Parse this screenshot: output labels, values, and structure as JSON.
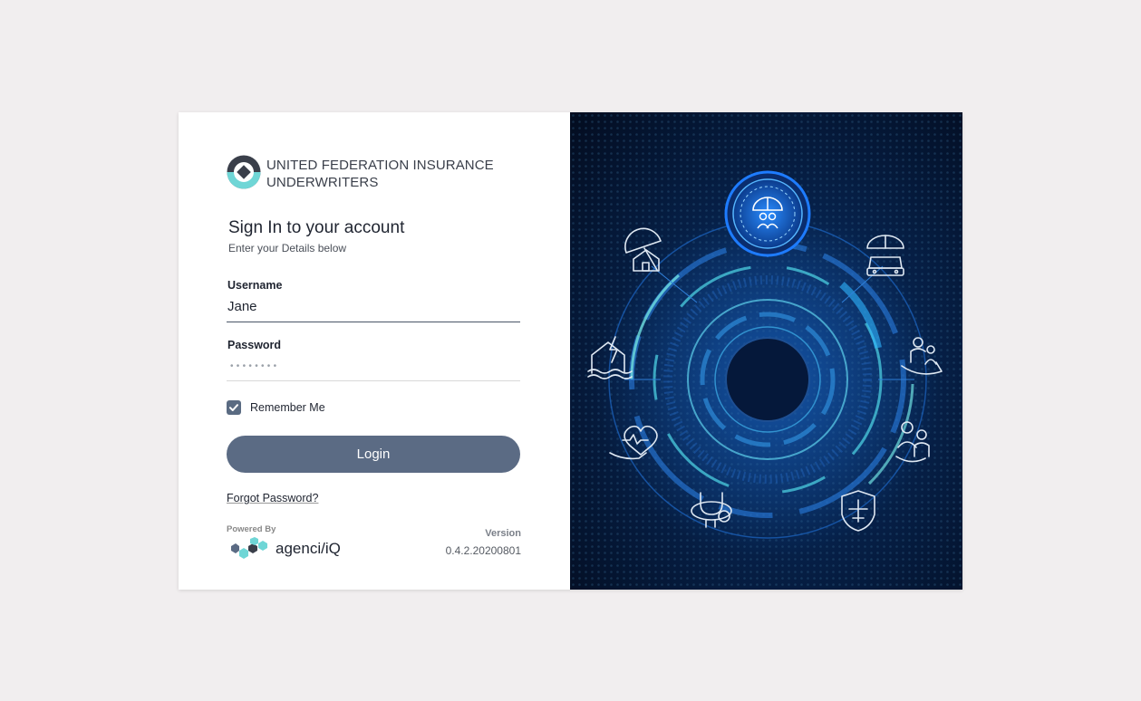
{
  "brand": {
    "line1": "UNITED FEDERATION INSURANCE",
    "line2": "UNDERWRITERS"
  },
  "signin": {
    "title": "Sign In to your account",
    "subtitle": "Enter your Details below"
  },
  "username": {
    "label": "Username",
    "value": "Jane"
  },
  "password": {
    "label": "Password",
    "masked": "••••••••"
  },
  "remember": {
    "label": "Remember Me",
    "checked": true
  },
  "login": {
    "label": "Login"
  },
  "forgot": {
    "label": "Forgot Password?"
  },
  "footer": {
    "powered_by": "Powered By",
    "product": "agenci/iQ",
    "version_label": "Version",
    "version": "0.4.2.20200801"
  },
  "colors": {
    "accent": "#5b6b84",
    "teal": "#6fd6d6",
    "dark": "#3a3f4a",
    "panel_bg": "#06214a"
  },
  "hero_icons": [
    "family-umbrella-icon",
    "home-umbrella-icon",
    "car-umbrella-icon",
    "house-disaster-icon",
    "family-care-icon",
    "health-heart-icon",
    "caregiver-icon",
    "stethoscope-icon",
    "travel-shield-icon"
  ]
}
